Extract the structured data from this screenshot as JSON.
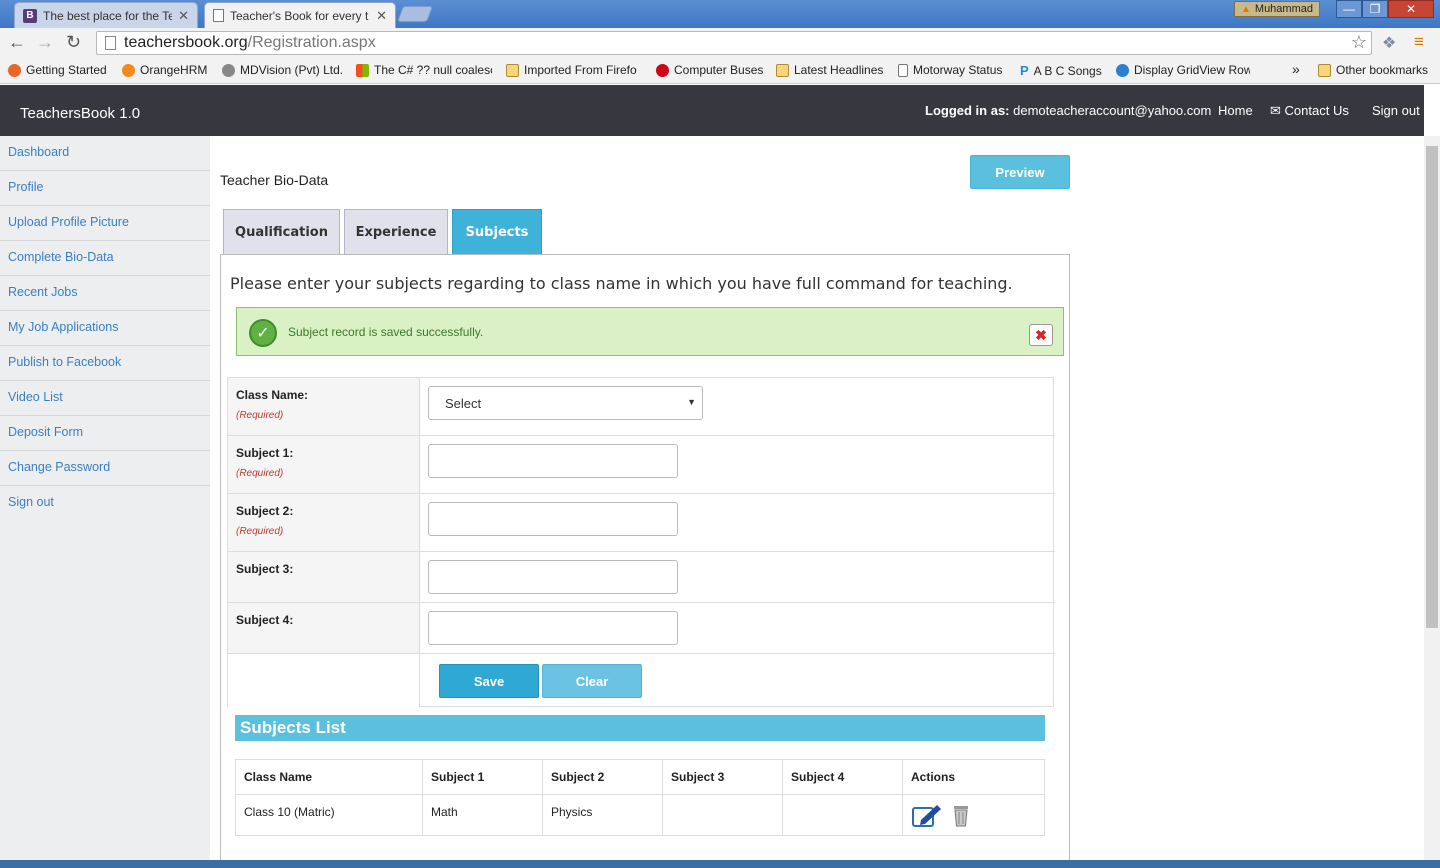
{
  "browser": {
    "tabs": [
      {
        "favicon": "B",
        "title": "The best place for the Tea"
      },
      {
        "favicon": "page",
        "title": "Teacher's Book for every t"
      }
    ],
    "user": "Muhammad",
    "url_host": "teachersbook.org",
    "url_path": "/Registration.aspx",
    "bookmarks": [
      "Getting Started",
      "OrangeHRM",
      "MDVision (Pvt) Ltd.",
      "The C# ?? null coalesc",
      "Imported From Firefo",
      "Computer Buses",
      "Latest Headlines",
      "Motorway Status",
      "A B C Songs",
      "Display GridView Row"
    ],
    "overflow": "»",
    "other_bookmarks": "Other bookmarks"
  },
  "site": {
    "brand": "TeachersBook 1.0",
    "logged_label": "Logged in as:",
    "logged_email": "demoteacheraccount@yahoo.com",
    "nav_home": "Home",
    "nav_contact": "Contact Us",
    "nav_signout": "Sign out"
  },
  "sidebar": {
    "items": [
      "Dashboard",
      "Profile",
      "Upload Profile Picture",
      "Complete Bio-Data",
      "Recent Jobs",
      "My Job Applications",
      "Publish to Facebook",
      "Video List",
      "Deposit Form",
      "Change Password",
      "Sign out"
    ]
  },
  "main": {
    "title": "Teacher Bio-Data",
    "preview": "Preview",
    "tabs": [
      "Qualification",
      "Experience",
      "Subjects"
    ],
    "intro": "Please enter your subjects regarding to class name in which you have full command for teaching.",
    "alert": "Subject record is saved successfully.",
    "form": {
      "class_label": "Class Name:",
      "class_selected": "Select",
      "required": "(Required)",
      "subject1": "Subject 1:",
      "subject2": "Subject 2:",
      "subject3": "Subject 3:",
      "subject4": "Subject 4:",
      "save": "Save",
      "clear": "Clear"
    },
    "list_title": "Subjects List",
    "table": {
      "headers": [
        "Class Name",
        "Subject 1",
        "Subject 2",
        "Subject 3",
        "Subject 4",
        "Actions"
      ],
      "rows": [
        [
          "Class 10 (Matric)",
          "Math",
          "Physics",
          "",
          ""
        ]
      ]
    }
  }
}
